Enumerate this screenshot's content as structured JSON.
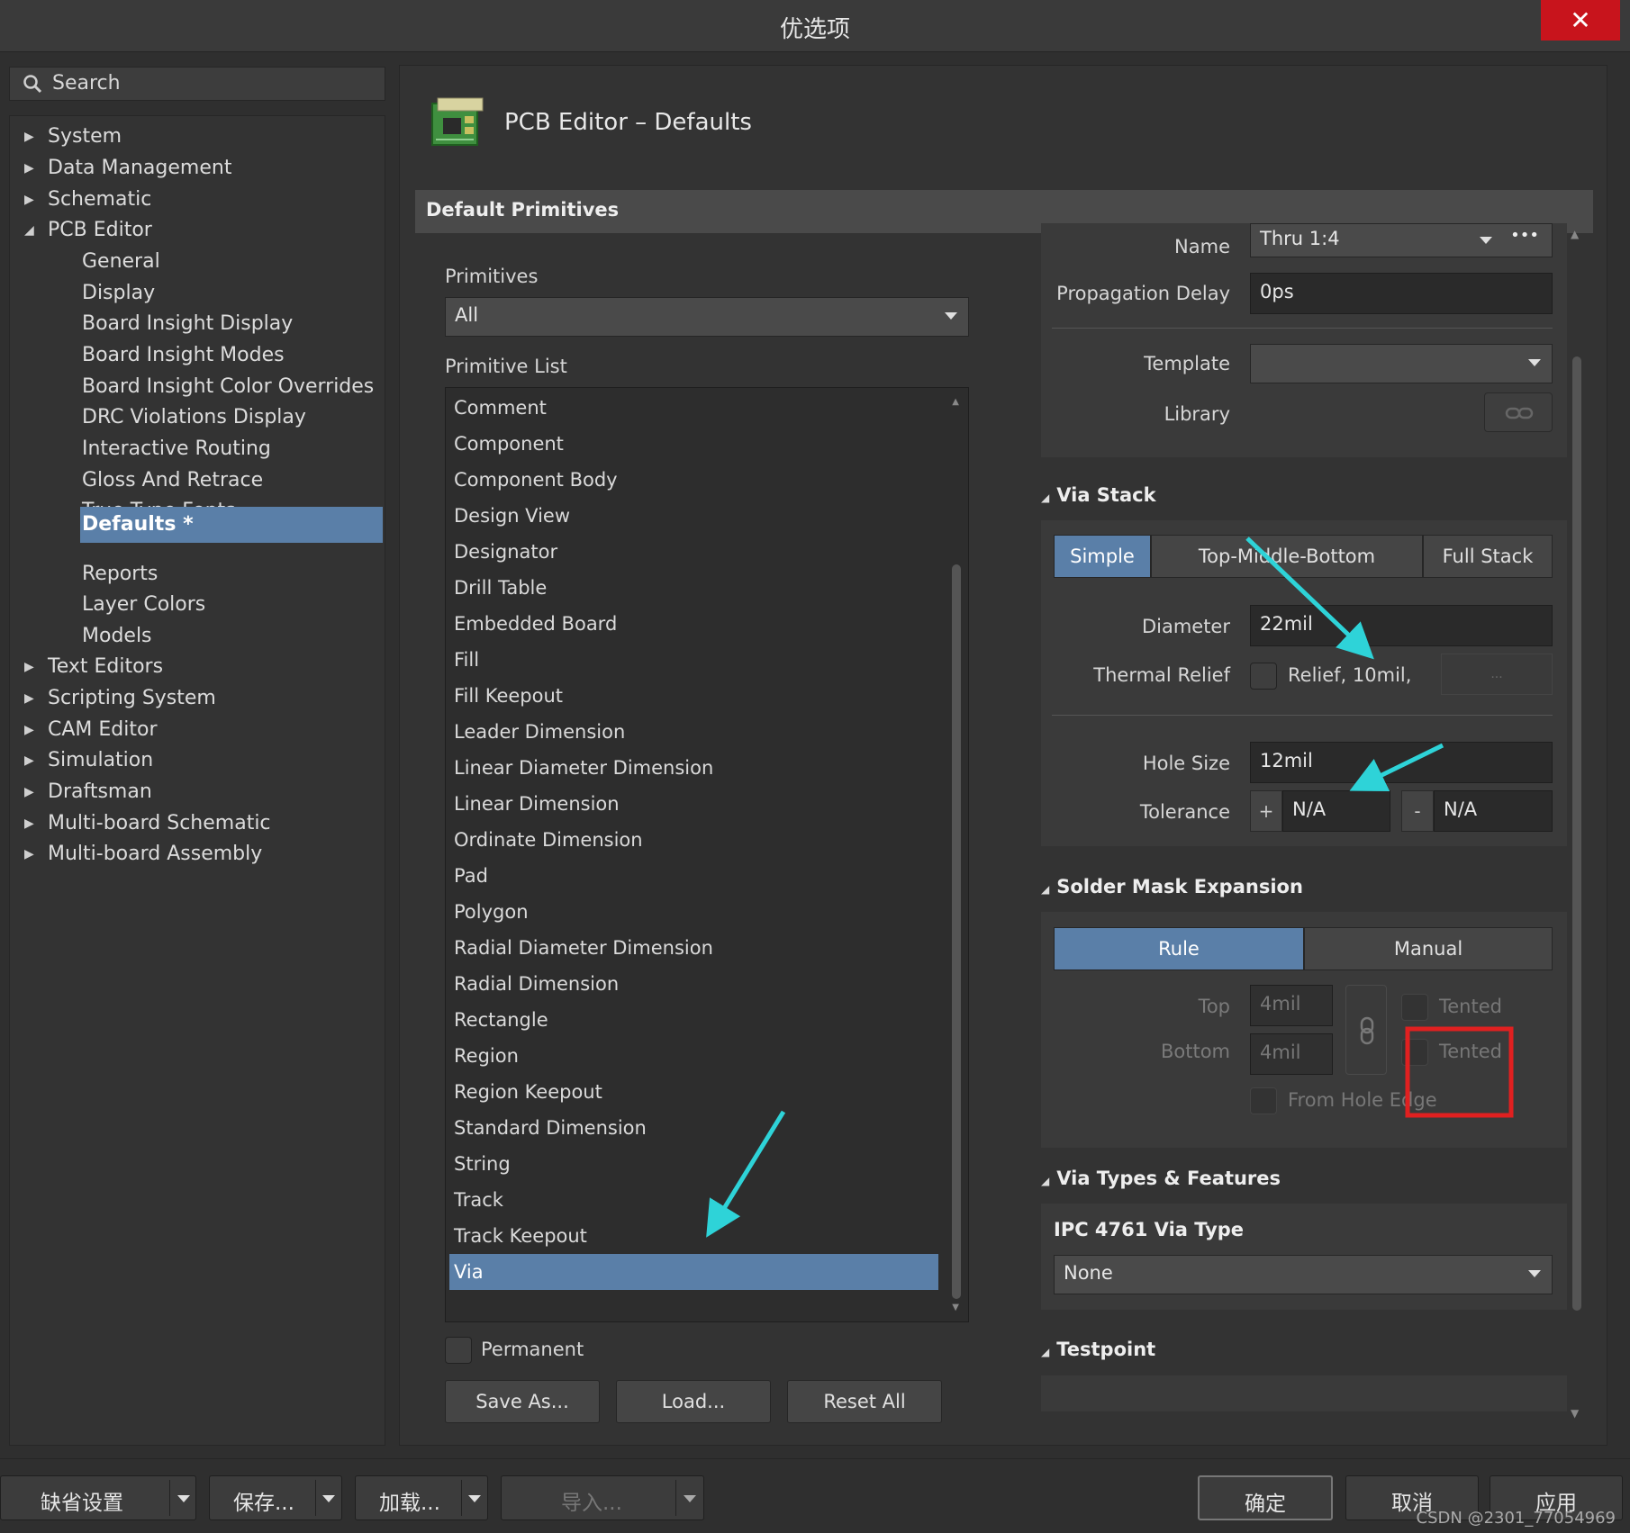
{
  "window": {
    "title": "优选项",
    "close_glyph": "✕"
  },
  "search": {
    "placeholder": "Search"
  },
  "tree": {
    "items": [
      {
        "label": "System",
        "arrow": "▶"
      },
      {
        "label": "Data Management",
        "arrow": "▶"
      },
      {
        "label": "Schematic",
        "arrow": "▶"
      },
      {
        "label": "PCB Editor",
        "arrow": "◢"
      },
      {
        "label": "General"
      },
      {
        "label": "Display"
      },
      {
        "label": "Board Insight Display"
      },
      {
        "label": "Board Insight Modes"
      },
      {
        "label": "Board Insight Color Overrides"
      },
      {
        "label": "DRC Violations Display"
      },
      {
        "label": "Interactive Routing"
      },
      {
        "label": "Gloss And Retrace"
      },
      {
        "label": "True Type Fonts"
      },
      {
        "label": "Defaults *"
      },
      {
        "label": "Reports"
      },
      {
        "label": "Layer Colors"
      },
      {
        "label": "Models"
      },
      {
        "label": "Text Editors",
        "arrow": "▶"
      },
      {
        "label": "Scripting System",
        "arrow": "▶"
      },
      {
        "label": "CAM Editor",
        "arrow": "▶"
      },
      {
        "label": "Simulation",
        "arrow": "▶"
      },
      {
        "label": "Draftsman",
        "arrow": "▶"
      },
      {
        "label": "Multi-board Schematic",
        "arrow": "▶"
      },
      {
        "label": "Multi-board Assembly",
        "arrow": "▶"
      }
    ]
  },
  "page": {
    "title": "PCB Editor – Defaults",
    "section": "Default Primitives"
  },
  "primitives": {
    "label": "Primitives",
    "selected": "All",
    "list_label": "Primitive List",
    "items": [
      "Comment",
      "Component",
      "Component Body",
      "Design View",
      "Designator",
      "Drill Table",
      "Embedded Board",
      "Fill",
      "Fill Keepout",
      "Leader Dimension",
      "Linear Diameter Dimension",
      "Linear Dimension",
      "Ordinate Dimension",
      "Pad",
      "Polygon",
      "Radial Diameter Dimension",
      "Radial Dimension",
      "Rectangle",
      "Region",
      "Region Keepout",
      "Standard Dimension",
      "String",
      "Track",
      "Track Keepout",
      "Via"
    ],
    "selected_item": "Via",
    "permanent_label": "Permanent",
    "save_as": "Save As...",
    "load": "Load...",
    "reset_all": "Reset All"
  },
  "props": {
    "name_label": "Name",
    "name_value": "Thru 1:4",
    "more_glyph": "•••",
    "prop_delay_label": "Propagation Delay",
    "prop_delay_value": "0ps",
    "template_label": "Template",
    "template_value": "",
    "library_label": "Library",
    "via_stack": {
      "title": "Via Stack",
      "tabs": [
        "Simple",
        "Top-Middle-Bottom",
        "Full Stack"
      ],
      "active_tab": "Simple",
      "diameter_label": "Diameter",
      "diameter_value": "22mil",
      "thermal_label": "Thermal Relief",
      "thermal_value": "Relief, 10mil,",
      "thermal_more": "...",
      "hole_label": "Hole Size",
      "hole_value": "12mil",
      "tolerance_label": "Tolerance",
      "tol_plus": "+",
      "tol_plus_value": "N/A",
      "tol_minus": "-",
      "tol_minus_value": "N/A"
    },
    "solder_mask": {
      "title": "Solder Mask Expansion",
      "tabs": [
        "Rule",
        "Manual"
      ],
      "active_tab": "Rule",
      "top_label": "Top",
      "top_value": "4mil",
      "bottom_label": "Bottom",
      "bottom_value": "4mil",
      "tented_top": "Tented",
      "tented_bottom": "Tented",
      "from_hole_edge": "From Hole Edge"
    },
    "via_types": {
      "title": "Via Types & Features",
      "ipc_label": "IPC 4761 Via Type",
      "ipc_value": "None"
    },
    "testpoint": {
      "title": "Testpoint"
    }
  },
  "bottom": {
    "defaults": "缺省设置",
    "save": "保存...",
    "load": "加载...",
    "import": "导入...",
    "ok": "确定",
    "cancel": "取消",
    "apply": "应用"
  },
  "watermark": "CSDN @2301_77054969",
  "colors": {
    "accent": "#5a7fa8",
    "close": "#c8141c",
    "annotation_arrow": "#2ed3d8",
    "annotation_box": "#e02020"
  }
}
